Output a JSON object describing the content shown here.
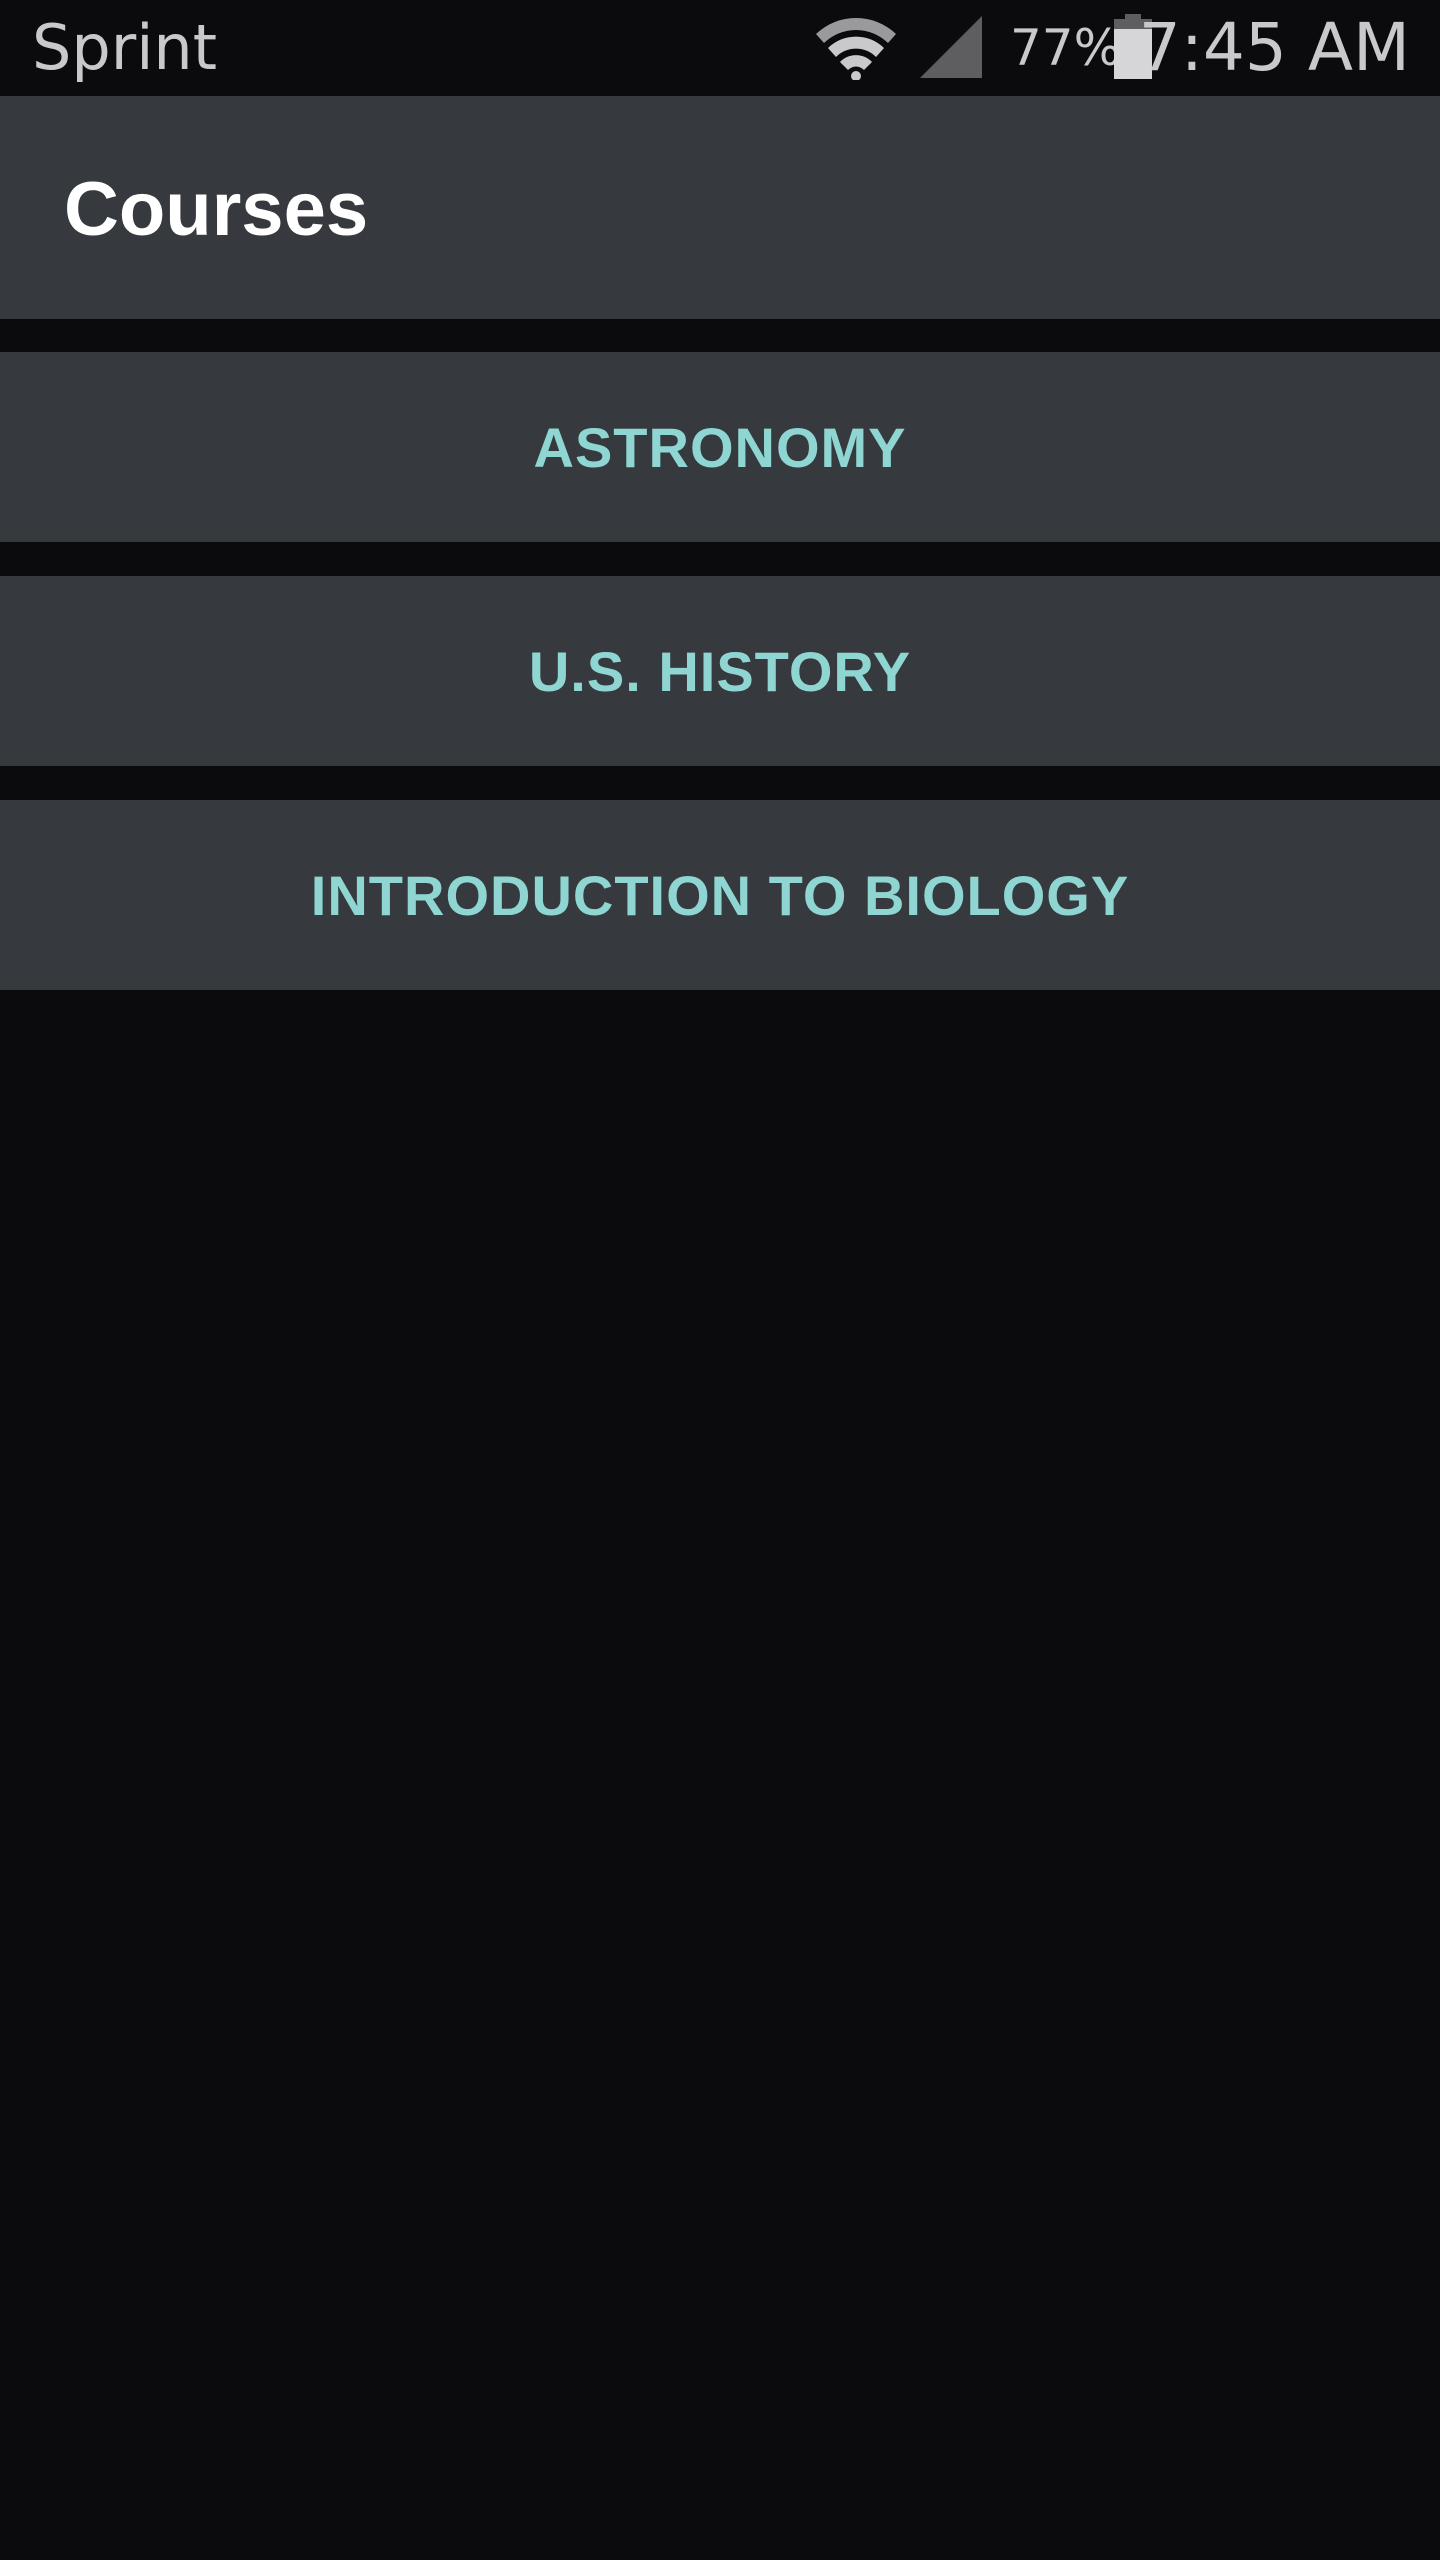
{
  "status_bar": {
    "carrier": "Sprint",
    "battery_percent": "77%",
    "time": "7:45 AM",
    "icons": [
      "wifi-icon",
      "cell-signal-icon",
      "battery-icon"
    ]
  },
  "app_bar": {
    "title": "Courses"
  },
  "courses": [
    {
      "label": "ASTRONOMY"
    },
    {
      "label": "U.S. HISTORY"
    },
    {
      "label": "INTRODUCTION TO BIOLOGY"
    }
  ],
  "colors": {
    "background": "#0b0a0d",
    "surface": "#363a3e",
    "accent": "#8fd6d3",
    "status_text": "#c9c9cb"
  }
}
